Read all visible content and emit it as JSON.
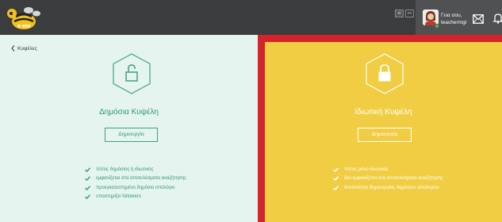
{
  "header": {
    "languages": [
      "el",
      "en"
    ],
    "greeting_line1": "Γεια σου,",
    "greeting_line2": "teachermgi",
    "icons": [
      "e-me-logo",
      "mail-icon",
      "bell-icon"
    ]
  },
  "nav": {
    "back_label": "Κυψέλες"
  },
  "public_hive": {
    "title": "Δημόσια Κυψέλη",
    "button_label": "Δημιουργία",
    "features": [
      "τύπος δημόσιος ή ιδιωτικός",
      "εμφανίζεται στα αποτελέσματα αναζήτησης",
      "προεγκατεστημένο δημόσιο ιστολόγιο",
      "υποστηρίζει followers"
    ],
    "accent_color": "#2b9a78"
  },
  "private_hive": {
    "title": "Ιδιωτική Κυψέλη",
    "button_label": "Δημιουργία",
    "features": [
      "τύπος μόνο ιδιωτικός",
      "δεν εμφανίζεται στα αποτελέσματα αναζήτησης",
      "δυνατότητα δημιουργίας δημόσιου ιστολογίου"
    ],
    "background_color": "#f0cd42",
    "selected_border_color": "#d4242b"
  }
}
